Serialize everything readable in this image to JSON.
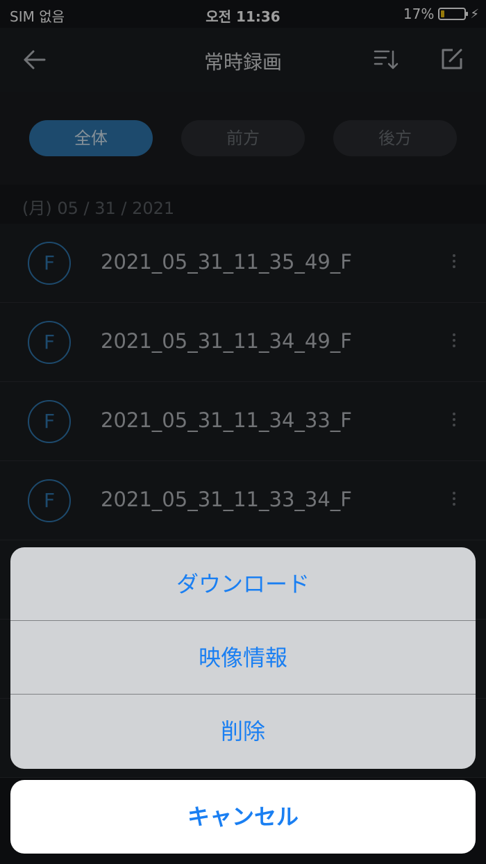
{
  "status_bar": {
    "carrier": "SIM 없음",
    "time": "오전 11:36",
    "battery": "17%",
    "battery_level": 0.17
  },
  "header": {
    "title": "常時録画",
    "icons": {
      "back": "arrow-left-icon",
      "sort": "sort-icon",
      "edit": "edit-icon"
    }
  },
  "filters": {
    "all": "全体",
    "front": "前方",
    "rear": "後方",
    "active": "all"
  },
  "date_header": "(月) 05 / 31 / 2021",
  "recordings": [
    {
      "badge": "F",
      "name": "2021_05_31_11_35_49_F"
    },
    {
      "badge": "F",
      "name": "2021_05_31_11_34_49_F"
    },
    {
      "badge": "F",
      "name": "2021_05_31_11_34_33_F"
    },
    {
      "badge": "F",
      "name": "2021_05_31_11_33_34_F"
    },
    {
      "badge": "",
      "name": ""
    },
    {
      "badge": "",
      "name": ""
    },
    {
      "badge": "",
      "name": ""
    }
  ],
  "action_sheet": {
    "download": "ダウンロード",
    "video_info": "映像情報",
    "delete": "削除",
    "cancel": "キャンセル"
  },
  "colors": {
    "accent": "#2f78b0",
    "ios_blue": "#1a7ff2",
    "background": "#141619"
  }
}
